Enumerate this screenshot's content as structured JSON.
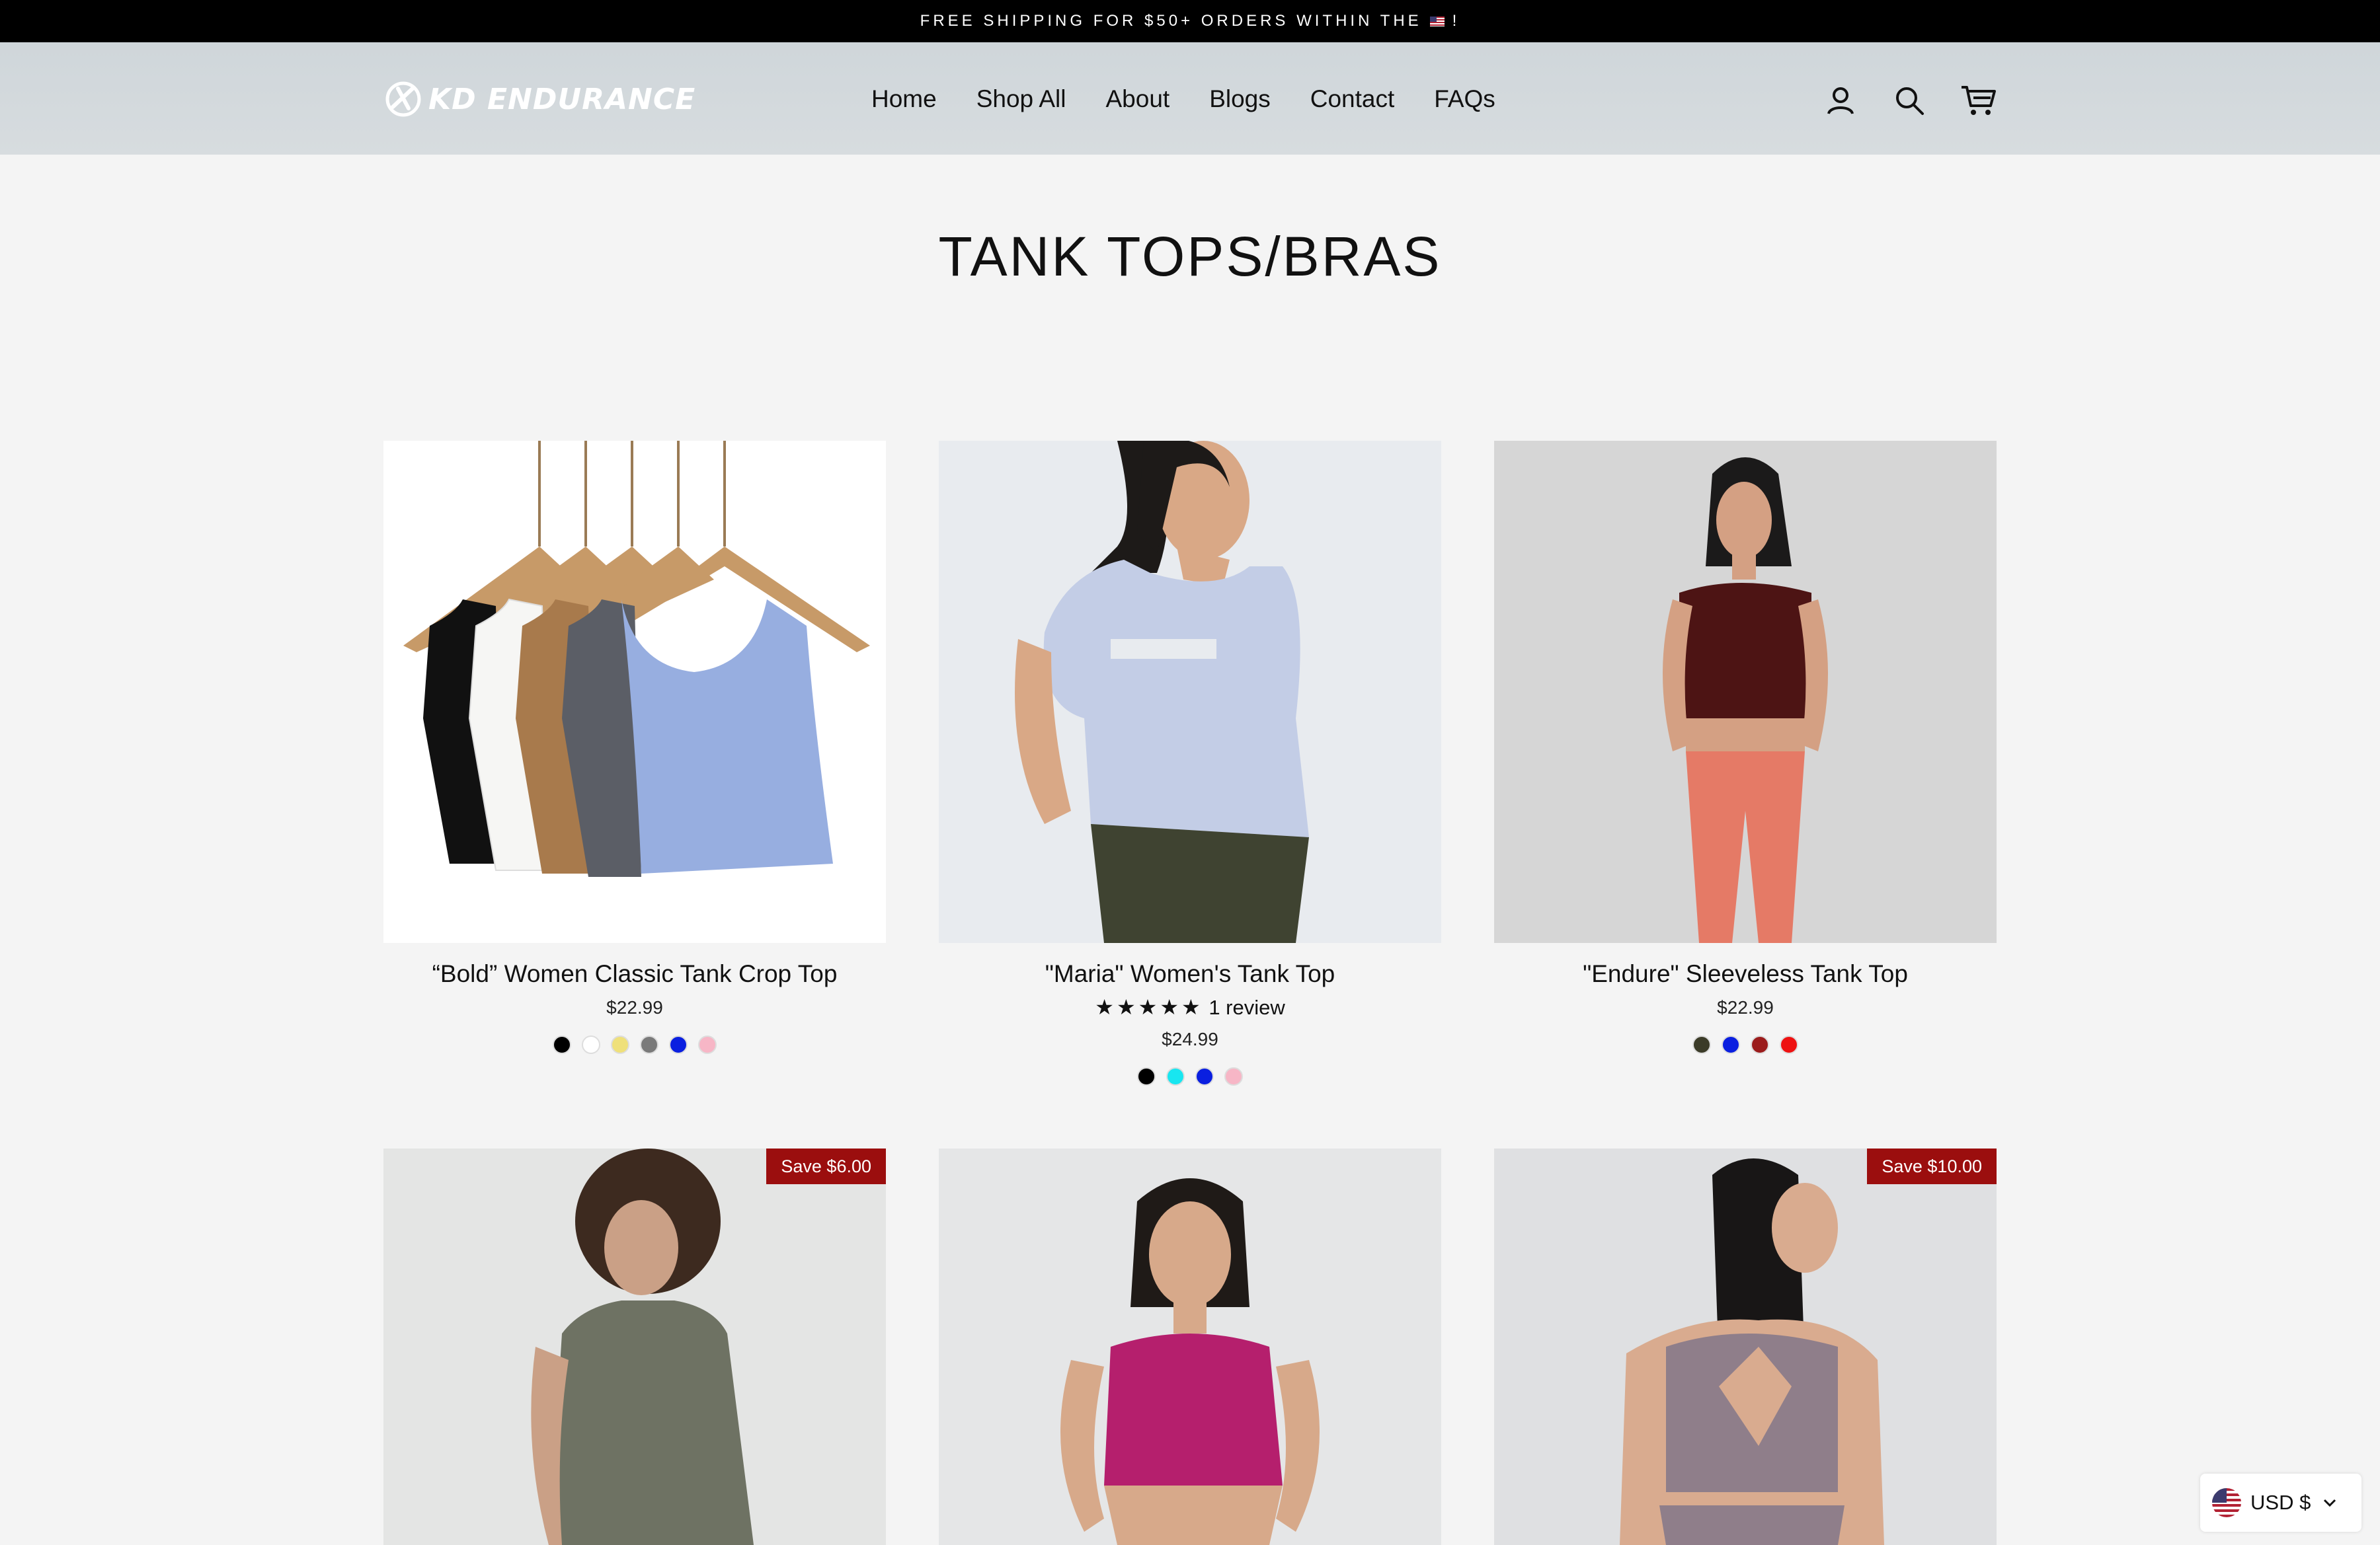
{
  "announcement": {
    "text_before": "FREE SHIPPING FOR $50+ ORDERS WITHIN THE",
    "flag_icon": "us-flag-icon",
    "text_after": "!"
  },
  "header": {
    "logo_text": "KD ENDURANCE",
    "nav": [
      "Home",
      "Shop All",
      "About",
      "Blogs",
      "Contact",
      "FAQs"
    ],
    "icons": [
      "account-icon",
      "search-icon",
      "cart-icon"
    ]
  },
  "page": {
    "title": "TANK TOPS/BRAS"
  },
  "products": [
    {
      "title": "“Bold” Women Classic Tank Crop Top",
      "price": "$22.99",
      "swatches": [
        "#000000",
        "#ffffff",
        "#efe07a",
        "#7a7a7a",
        "#0a1fe0",
        "#f7b6c6"
      ]
    },
    {
      "title": "\"Maria\" Women's Tank Top",
      "rating_stars": "★★★★★",
      "rating_value": 5,
      "review_text": "1 review",
      "price": "$24.99",
      "swatches": [
        "#000000",
        "#18e6f0",
        "#0a1fe0",
        "#f7b6c6"
      ]
    },
    {
      "title": "\"Endure\" Sleeveless Tank Top",
      "price": "$22.99",
      "swatches": [
        "#3b3b28",
        "#0a1fe0",
        "#9b1c1c",
        "#ee1111"
      ]
    },
    {
      "badge": "Save $6.00"
    },
    {},
    {
      "badge": "Save $10.00"
    }
  ],
  "currency": {
    "label": "USD $"
  },
  "colors": {
    "accent_badge": "#9b0e0e",
    "announcement_bg": "#000000"
  }
}
